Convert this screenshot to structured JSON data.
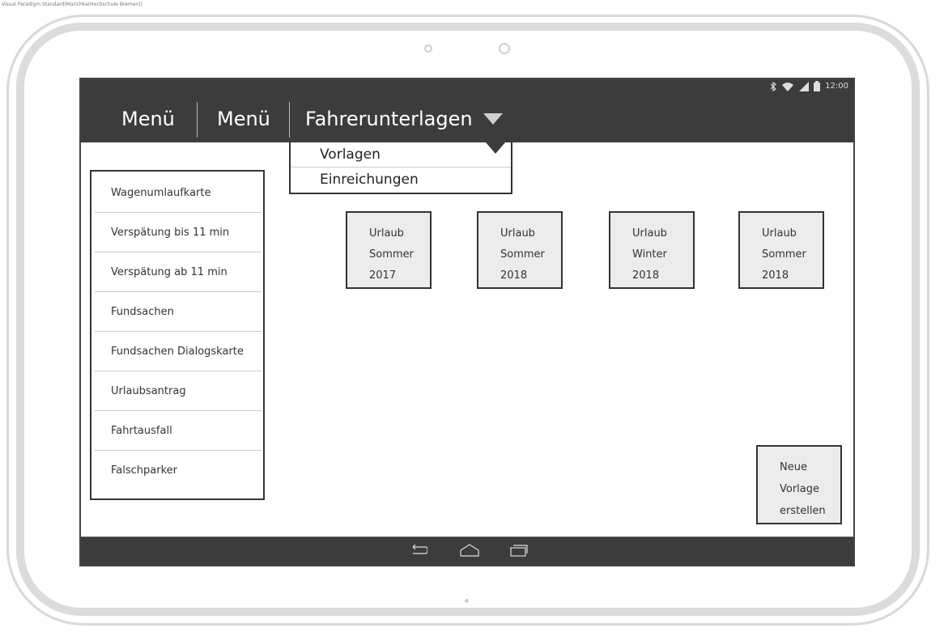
{
  "watermark": "Visual Paradigm Standard(Marichka(Hochschule Bremen))",
  "status_bar": {
    "time": "12:00",
    "icons": [
      "bluetooth-icon",
      "wifi-icon",
      "signal-icon",
      "battery-icon"
    ]
  },
  "app_bar": {
    "menu_1": "Menü",
    "menu_2": "Menü",
    "menu_3": "Fahrerunterlagen"
  },
  "dropdown": {
    "items": [
      "Vorlagen",
      "Einreichungen"
    ]
  },
  "sidebar": {
    "items": [
      "Wagenumlaufkarte",
      "Verspätung bis 11 min",
      "Verspätung ab 11 min",
      "Fundsachen",
      "Fundsachen Dialogskarte",
      "Urlaubsantrag",
      "Fahrtausfall",
      "Falschparker"
    ]
  },
  "tiles": [
    {
      "line1": "Urlaub",
      "line2": "Sommer",
      "line3": "2017"
    },
    {
      "line1": "Urlaub",
      "line2": "Sommer",
      "line3": "2018"
    },
    {
      "line1": "Urlaub",
      "line2": "Winter",
      "line3": "2018"
    },
    {
      "line1": "Urlaub",
      "line2": "Sommer",
      "line3": "2018"
    }
  ],
  "new_template_button": {
    "line1": "Neue",
    "line2": "Vorlage",
    "line3": "erstellen"
  },
  "colors": {
    "bar": "#3c3c3c",
    "tile": "#ececec",
    "frame": "#dcdcdc"
  }
}
